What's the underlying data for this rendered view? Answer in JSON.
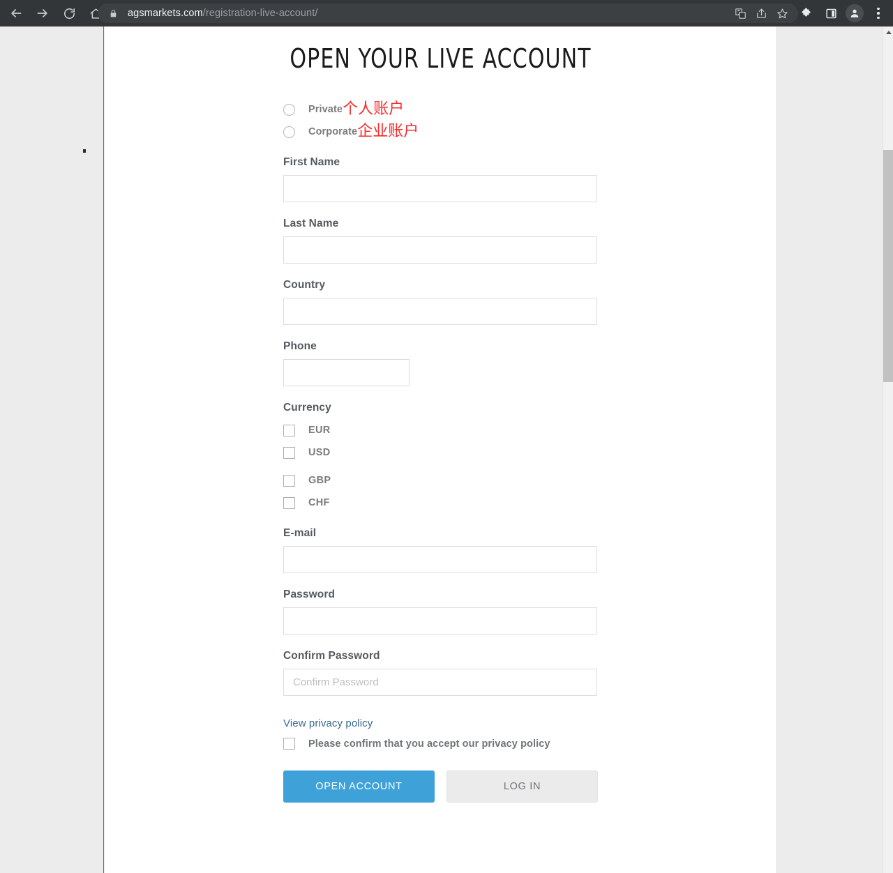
{
  "browser": {
    "nav": {
      "back_icon": "arrow-left-icon",
      "forward_icon": "arrow-right-icon",
      "reload_icon": "reload-icon",
      "home_icon": "home-icon"
    },
    "omnibox": {
      "lock_icon": "lock-icon",
      "domain": "agsmarkets.com",
      "path": "/registration-live-account/",
      "translate_icon": "translate-icon",
      "share_icon": "share-icon",
      "bookmark_icon": "star-icon"
    },
    "toolbar_right": {
      "extensions_icon": "puzzle-icon",
      "side_panel_icon": "side-panel-icon",
      "profile_icon": "person-icon",
      "menu_icon": "three-dots-menu-icon"
    }
  },
  "scrollbar": {
    "up_arrow_icon": "scroll-up-arrow-icon"
  },
  "page": {
    "title": "OPEN YOUR LIVE ACCOUNT",
    "account_type": {
      "options": [
        {
          "label": "Private",
          "translation": "个人账户",
          "selected": false
        },
        {
          "label": "Corporate",
          "translation": "企业账户",
          "selected": false
        }
      ]
    },
    "fields": {
      "first_name": {
        "label": "First Name",
        "value": "",
        "placeholder": ""
      },
      "last_name": {
        "label": "Last Name",
        "value": "",
        "placeholder": ""
      },
      "country": {
        "label": "Country",
        "value": "",
        "placeholder": ""
      },
      "phone": {
        "label": "Phone",
        "value": "",
        "placeholder": ""
      },
      "email": {
        "label": "E-mail",
        "value": "",
        "placeholder": ""
      },
      "password": {
        "label": "Password",
        "value": "",
        "placeholder": ""
      },
      "confirm_password": {
        "label": "Confirm Password",
        "value": "",
        "placeholder": "Confirm Password"
      }
    },
    "currency": {
      "label": "Currency",
      "options": [
        {
          "label": "EUR",
          "checked": false
        },
        {
          "label": "USD",
          "checked": false
        },
        {
          "label": "GBP",
          "checked": false
        },
        {
          "label": "CHF",
          "checked": false
        }
      ]
    },
    "privacy": {
      "link_text": "View privacy policy",
      "consent_text": "Please confirm that you accept our privacy policy",
      "checked": false
    },
    "buttons": {
      "open_account": "OPEN ACCOUNT",
      "log_in": "LOG IN"
    }
  },
  "colors": {
    "primary_button": "#3ea2d8",
    "secondary_button": "#ebebeb",
    "link": "#3a6a8f",
    "translation_text": "#fb2b2b",
    "label": "#555a60",
    "chrome": "#323639"
  }
}
